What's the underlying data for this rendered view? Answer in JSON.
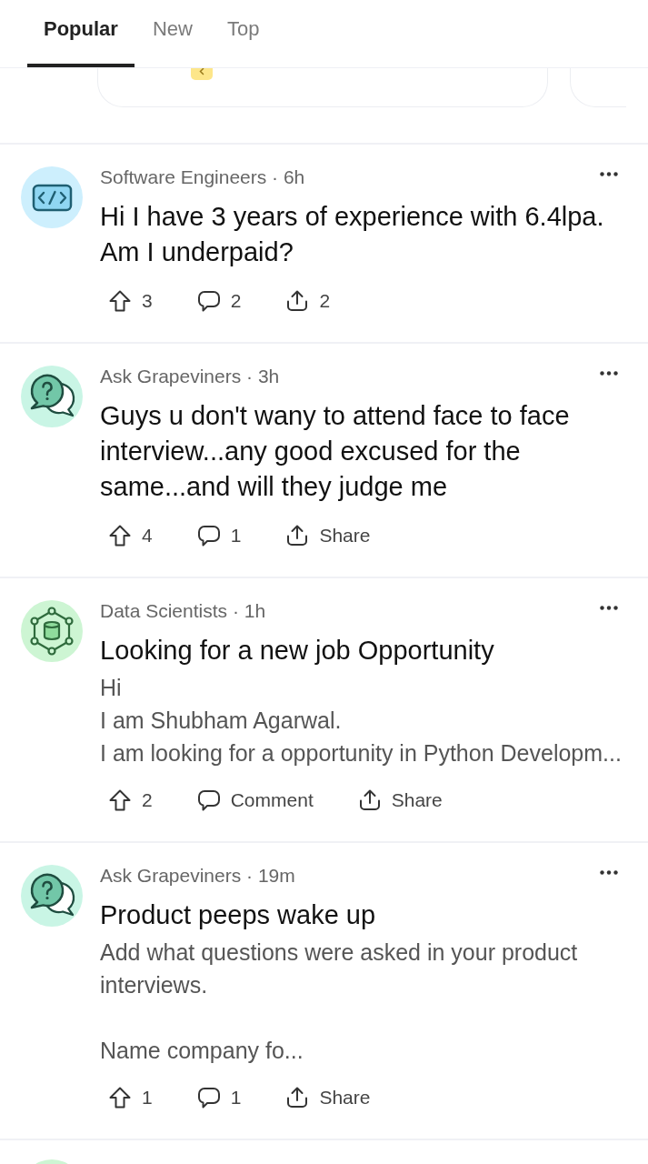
{
  "tabs": [
    {
      "label": "Popular",
      "selected": true
    },
    {
      "label": "New",
      "selected": false
    },
    {
      "label": "Top",
      "selected": false
    }
  ],
  "posts": [
    {
      "kind": "code",
      "meta": "Software Engineers · 6h",
      "title": "Hi I have 3 years of experience with 6.4lpa. Am I underpaid?",
      "actions": [
        {
          "kind": "upvote",
          "label": "3"
        },
        {
          "kind": "comment",
          "label": "2"
        },
        {
          "kind": "share",
          "label": "2"
        }
      ]
    },
    {
      "kind": "question",
      "meta": "Ask Grapeviners · 3h",
      "title": "Guys u don't wany to attend face to face interview...any good excused for the same...and will they judge me",
      "actions": [
        {
          "kind": "upvote",
          "label": "4"
        },
        {
          "kind": "comment",
          "label": "1"
        },
        {
          "kind": "share",
          "label": "Share"
        }
      ]
    },
    {
      "kind": "network",
      "meta": "Data Scientists · 1h",
      "title": "Looking for a new job Opportunity",
      "body": "Hi\nI am Shubham Agarwal.\nI am looking for a opportunity in Python Developm...",
      "actions": [
        {
          "kind": "upvote",
          "label": "2"
        },
        {
          "kind": "comment",
          "label": "Comment"
        },
        {
          "kind": "share",
          "label": "Share"
        }
      ]
    },
    {
      "kind": "question",
      "meta": "Ask Grapeviners · 19m",
      "title": "Product peeps wake up",
      "body": "Add what questions were asked in your product interviews.\n\nName company fo...",
      "actions": [
        {
          "kind": "upvote",
          "label": "1"
        },
        {
          "kind": "comment",
          "label": "1"
        },
        {
          "kind": "share",
          "label": "Share"
        }
      ]
    }
  ]
}
